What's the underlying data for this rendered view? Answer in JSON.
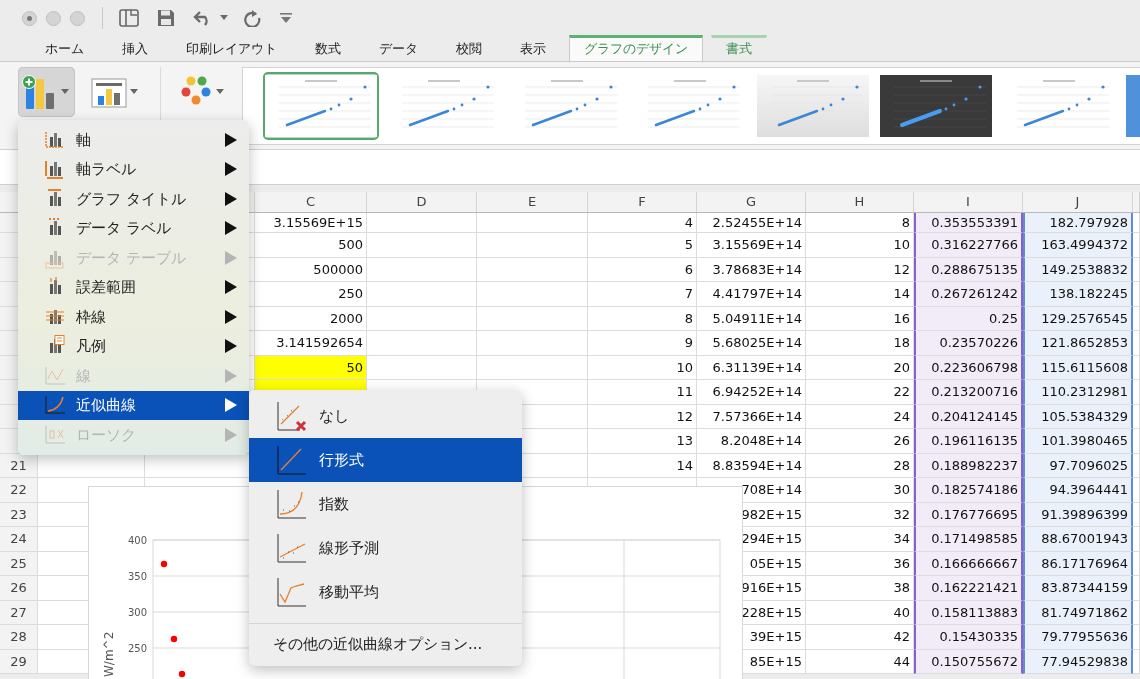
{
  "tabs": [
    {
      "label": "ホーム",
      "selected": false,
      "contextual": false
    },
    {
      "label": "挿入",
      "selected": false,
      "contextual": false
    },
    {
      "label": "印刷レイアウト",
      "selected": false,
      "contextual": false
    },
    {
      "label": "数式",
      "selected": false,
      "contextual": false
    },
    {
      "label": "データ",
      "selected": false,
      "contextual": false
    },
    {
      "label": "校閲",
      "selected": false,
      "contextual": false
    },
    {
      "label": "表示",
      "selected": false,
      "contextual": false
    },
    {
      "label": "グラフのデザイン",
      "selected": true,
      "contextual": true
    },
    {
      "label": "書式",
      "selected": false,
      "contextual": true
    }
  ],
  "ribbon": {
    "buttons": [
      {
        "kind": "add-element",
        "pressed": true
      },
      {
        "kind": "layout",
        "pressed": false
      },
      {
        "kind": "colors",
        "pressed": false
      }
    ],
    "styles": [
      {
        "kind": "light",
        "selected": true
      },
      {
        "kind": "light",
        "selected": false
      },
      {
        "kind": "light",
        "selected": false
      },
      {
        "kind": "light",
        "selected": false
      },
      {
        "kind": "gradient",
        "selected": false
      },
      {
        "kind": "dark",
        "selected": false
      },
      {
        "kind": "light",
        "selected": false
      },
      {
        "kind": "blue",
        "selected": false
      }
    ]
  },
  "menu": {
    "items": [
      {
        "label": "軸",
        "disabled": false,
        "selected": false
      },
      {
        "label": "軸ラベル",
        "disabled": false,
        "selected": false
      },
      {
        "label": "グラフ タイトル",
        "disabled": false,
        "selected": false
      },
      {
        "label": "データ ラベル",
        "disabled": false,
        "selected": false
      },
      {
        "label": "データ テーブル",
        "disabled": true,
        "selected": false
      },
      {
        "label": "誤差範囲",
        "disabled": false,
        "selected": false
      },
      {
        "label": "枠線",
        "disabled": false,
        "selected": false
      },
      {
        "label": "凡例",
        "disabled": false,
        "selected": false
      },
      {
        "label": "線",
        "disabled": true,
        "selected": false
      },
      {
        "label": "近似曲線",
        "disabled": false,
        "selected": true
      },
      {
        "label": "ローソク",
        "disabled": true,
        "selected": false
      }
    ]
  },
  "submenu": {
    "items": [
      {
        "label": "なし",
        "selected": false
      },
      {
        "label": "行形式",
        "selected": true
      },
      {
        "label": "指数",
        "selected": false
      },
      {
        "label": "線形予測",
        "selected": false
      },
      {
        "label": "移動平均",
        "selected": false
      }
    ],
    "more": "その他の近似曲線オプション..."
  },
  "sheet": {
    "columns": [
      {
        "label": "C"
      },
      {
        "label": "D"
      },
      {
        "label": "E"
      },
      {
        "label": "F"
      },
      {
        "label": "G"
      },
      {
        "label": "H"
      },
      {
        "label": "I",
        "color": "#8a5fc8"
      },
      {
        "label": "J",
        "color": "#5b8ddb"
      }
    ],
    "rows": [
      {
        "highlighted": false,
        "c": "3.15569E+15",
        "f": "4",
        "g": "2.52455E+14",
        "h": "8",
        "i": "0.353553391",
        "j": "182.797928"
      },
      {
        "highlighted": false,
        "c": "500",
        "f": "5",
        "g": "3.15569E+14",
        "h": "10",
        "i": "0.316227766",
        "j": "163.4994372"
      },
      {
        "highlighted": false,
        "c": "500000",
        "f": "6",
        "g": "3.78683E+14",
        "h": "12",
        "i": "0.288675135",
        "j": "149.2538832"
      },
      {
        "highlighted": false,
        "c": "250",
        "f": "7",
        "g": "4.41797E+14",
        "h": "14",
        "i": "0.267261242",
        "j": "138.182245"
      },
      {
        "highlighted": false,
        "c": "2000",
        "f": "8",
        "g": "5.04911E+14",
        "h": "16",
        "i": "0.25",
        "j": "129.2576545"
      },
      {
        "highlighted": false,
        "c": "3.141592654",
        "f": "9",
        "g": "5.68025E+14",
        "h": "18",
        "i": "0.23570226",
        "j": "121.8652853"
      },
      {
        "highlighted": true,
        "c": "50",
        "f": "10",
        "g": "6.31139E+14",
        "h": "20",
        "i": "0.223606798",
        "j": "115.6115608"
      },
      {
        "highlighted": true,
        "f": "11",
        "g": "6.94252E+14",
        "h": "22",
        "i": "0.213200716",
        "j": "110.2312981"
      },
      {
        "f": "12",
        "g": "7.57366E+14",
        "h": "24",
        "i": "0.204124145",
        "j": "105.5384329"
      },
      {
        "f": "13",
        "g": "8.2048E+14",
        "h": "26",
        "i": "0.196116135",
        "j": "101.3980465"
      },
      {
        "number": "21",
        "f": "14",
        "g": "8.83594E+14",
        "h": "28",
        "i": "0.188982237",
        "j": "97.7096025"
      },
      {
        "number": "22",
        "g": "708E+14",
        "h": "30",
        "i": "0.182574186",
        "j": "94.3964441"
      },
      {
        "number": "23",
        "g": "982E+15",
        "h": "32",
        "i": "0.176776695",
        "j": "91.39896399"
      },
      {
        "number": "24",
        "g": "294E+15",
        "h": "34",
        "i": "0.171498585",
        "j": "88.67001943"
      },
      {
        "number": "25",
        "g": "05E+15",
        "h": "36",
        "i": "0.166666667",
        "j": "86.17176964"
      },
      {
        "number": "26",
        "g": "916E+15",
        "h": "38",
        "i": "0.162221421",
        "j": "83.87344159"
      },
      {
        "number": "27",
        "g": "228E+15",
        "h": "40",
        "i": "0.158113883",
        "j": "81.74971862"
      },
      {
        "number": "28",
        "g": "39E+15",
        "h": "42",
        "i": "0.15430335",
        "j": "79.77955636"
      },
      {
        "number": "29",
        "g": "85E+15",
        "h": "44",
        "i": "0.150755672",
        "j": "77.94529838"
      }
    ]
  },
  "chart": {
    "axis_labels": [
      "400",
      "350",
      "300",
      "250"
    ],
    "axis_title": "W/m^2"
  }
}
